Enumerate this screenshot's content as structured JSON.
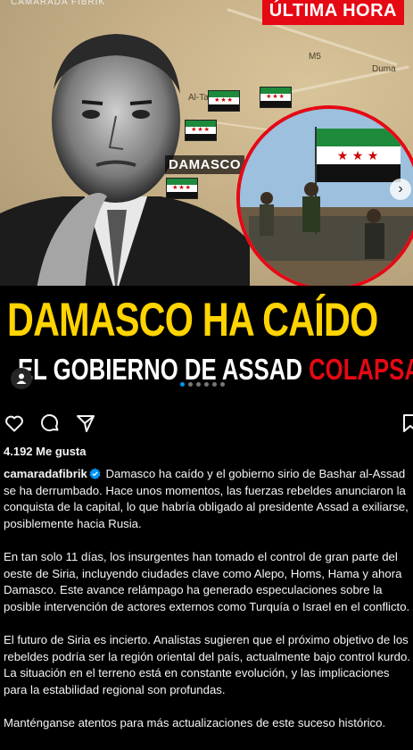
{
  "post": {
    "top_username": "CAMARADA FIBRIK",
    "badge": "ÚLTIMA HORA",
    "map": {
      "city": "DAMASCO",
      "places": [
        "Al-Tal",
        "Duma",
        "M5"
      ]
    },
    "headline_line1": "DAMASCO HA CAÍDO",
    "headline_line2_prefix": "EL GOBIERNO DE ASSAD",
    "headline_line2_highlight": "COLAPSA",
    "carousel_position": 1,
    "carousel_count": 6
  },
  "actions": {
    "like": "heart-icon",
    "comment": "comment-icon",
    "share": "share-icon",
    "save": "bookmark-icon"
  },
  "likes_text": "4.192 Me gusta",
  "caption": {
    "username": "camaradafibrik",
    "paragraph1": "Damasco ha caído y el gobierno sirio de Bashar al-Assad se ha derrumbado. Hace unos momentos, las fuerzas rebeldes anunciaron la conquista de la capital, lo que habría obligado al presidente Assad a exiliarse, posiblemente hacia Rusia.",
    "paragraph2": "En tan solo 11 días, los insurgentes han tomado el control de gran parte del oeste de Siria, incluyendo ciudades clave como Alepo, Homs, Hama y ahora Damasco. Este avance relámpago ha generado especulaciones sobre la posible intervención de actores externos como Turquía o Israel en el conflicto.",
    "paragraph3": "El futuro de Siria es incierto. Analistas sugieren que el próximo objetivo de los rebeldes podría ser la región oriental del país, actualmente bajo control kurdo. La situación en el terreno está en constante evolución, y las implicaciones para la estabilidad regional son profundas.",
    "paragraph4": "Manténganse atentos para más actualizaciones de este suceso histórico."
  },
  "colors": {
    "accent_red": "#e50914",
    "headline_yellow": "#ffd400",
    "verified_blue": "#0095f6"
  }
}
